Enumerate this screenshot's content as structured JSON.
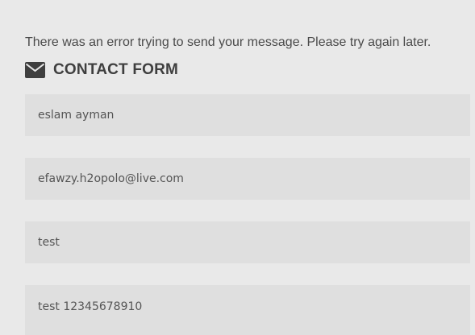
{
  "error_message": "There was an error trying to send your message. Please try again later.",
  "form": {
    "title": "CONTACT FORM",
    "icon": "envelope-icon",
    "fields": {
      "name": "eslam ayman",
      "email": "efawzy.h2opolo@live.com",
      "subject": "test",
      "message": "test 12345678910"
    }
  },
  "colors": {
    "background": "#e9e9e9",
    "field_background": "#dfdfdf",
    "text": "#4a4a4a"
  }
}
